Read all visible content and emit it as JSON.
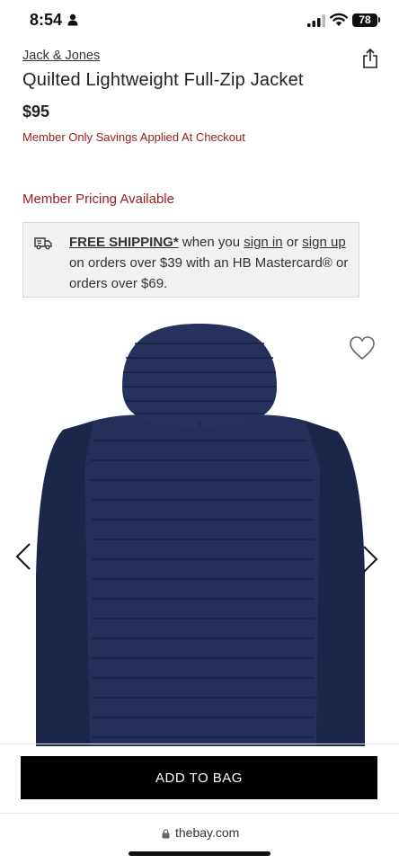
{
  "status_bar": {
    "time": "8:54",
    "battery": "78",
    "icons": [
      "person-icon",
      "signal-icon",
      "wifi-icon",
      "battery-icon"
    ]
  },
  "product": {
    "brand": "Jack & Jones",
    "title": "Quilted Lightweight Full-Zip Jacket",
    "price": "$95",
    "member_savings": "Member Only Savings Applied At Checkout",
    "member_pricing": "Member Pricing Available"
  },
  "shipping": {
    "free_shipping": "FREE SHIPPING*",
    "text_1": " when you ",
    "sign_in": "sign in",
    "text_2": " or ",
    "sign_up": "sign up",
    "text_3": " on orders over $39 with an HB Mastercard® or orders over $69."
  },
  "cta": {
    "add_to_bag": "ADD TO BAG"
  },
  "browser": {
    "url": "thebay.com"
  },
  "colors": {
    "accent_red": "#9b1c1c",
    "jacket_navy": "#1f2a4f",
    "button_black": "#000000"
  }
}
